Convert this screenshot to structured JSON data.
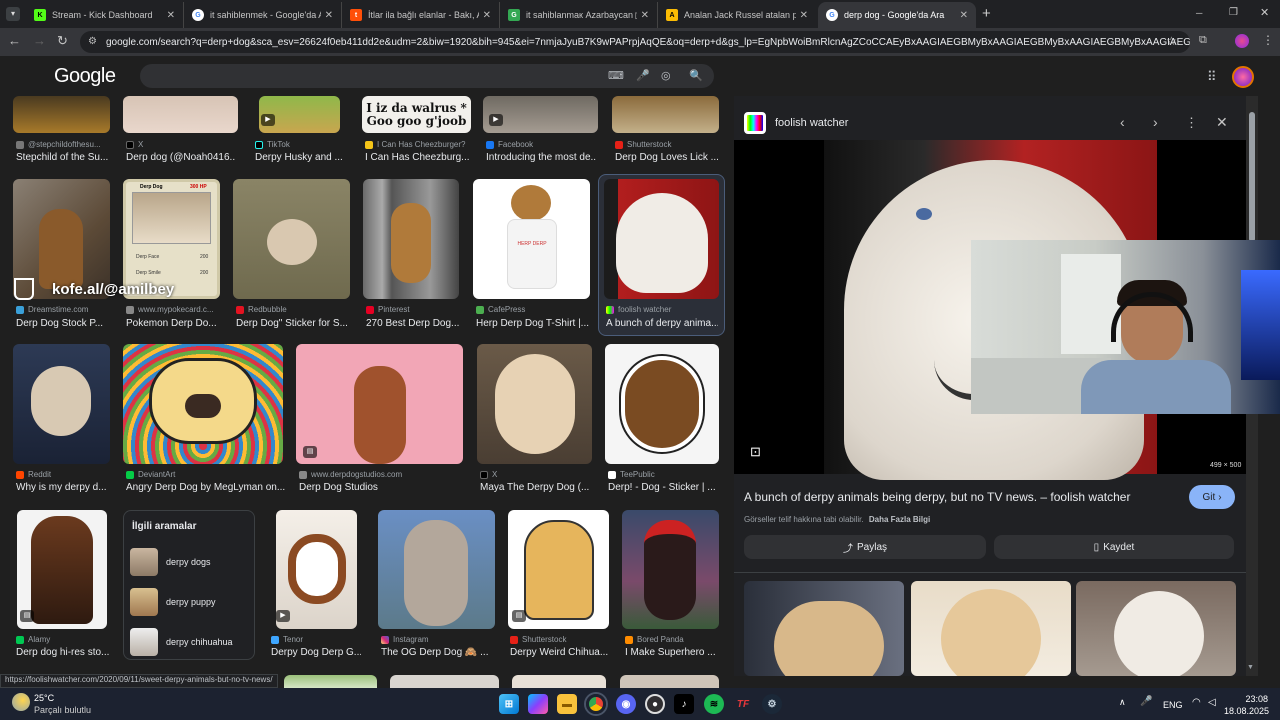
{
  "browser": {
    "tabs": [
      {
        "title": "Stream - Kick Dashboard",
        "active": false
      },
      {
        "title": "it sahiblenmek - Google'da Ara",
        "active": false
      },
      {
        "title": "İtlar ila bağlı elanlar - Bakı, Azə",
        "active": false
      },
      {
        "title": "it sahiblanmaк Azarbaycan ▷ M",
        "active": false
      },
      {
        "title": "Analan Jack Russel atalan pekin",
        "active": false
      },
      {
        "title": "derp dog - Google'da Ara",
        "active": true
      }
    ],
    "new_tab": "+",
    "window_controls": {
      "minimize": "─",
      "restore": "❐",
      "close": "✕"
    },
    "url": "google.com/search?q=derp+dog&sca_esv=26624f0eb411dd2e&udm=2&biw=1920&bih=945&ei=7nmjaJyuB7K9wPAPrpjAqQE&oq=derp+d&gs_lp=EgNpbWoiBmRlcnAgZCoCCAEyBxAAGIAEGBMyBxAAGIAEGBMyBxAAGIAEGBMyBxAAGIAEGBMyBxAAGIAEGBMyBxAAGIAEGBMyBxAAGIAEGBMyBxAAGIAEGBMyBxAAGIAEGBMyBxAAGIA..."
  },
  "google": {
    "logo": "Google"
  },
  "results_top": [
    {
      "source": "@stepchildofthesu...",
      "caption": "Stepchild of the Su..."
    },
    {
      "source": "X",
      "caption": "Derp dog (@Noah0416..."
    },
    {
      "source": "TikTok",
      "caption": "Derpy Husky and ..."
    },
    {
      "source": "I Can Has Cheezburger?",
      "caption": "I Can Has Cheezburg...",
      "meme_text": "I iz da walrus *\nGoo goo g'joob"
    },
    {
      "source": "Facebook",
      "caption": "Introducing the most de..."
    },
    {
      "source": "Shutterstock",
      "caption": "Derp Dog Loves Lick ..."
    }
  ],
  "results_row2": [
    {
      "source": "Dreamstime.com",
      "caption": "Derp Dog Stock P..."
    },
    {
      "source": "www.mypokecard.c...",
      "caption": "Pokemon Derp Do..."
    },
    {
      "source": "Redbubble",
      "caption": "Derp Dog\" Sticker for S..."
    },
    {
      "source": "Pinterest",
      "caption": "270 Best Derp Dog..."
    },
    {
      "source": "CafePress",
      "caption": "Herp Derp Dog T-Shirt |..."
    },
    {
      "source": "foolish watcher",
      "caption": "A bunch of derpy anima..."
    }
  ],
  "results_row3": [
    {
      "source": "Reddit",
      "caption": "Why is my derpy d..."
    },
    {
      "source": "DeviantArt",
      "caption": "Angry Derp Dog by MegLyman on..."
    },
    {
      "source": "www.derpdogstudios.com",
      "caption": "Derp Dog Studios"
    },
    {
      "source": "X",
      "caption": "Maya The Derpy Dog (..."
    },
    {
      "source": "TeePublic",
      "caption": "Derp! - Dog - Sticker | ..."
    }
  ],
  "results_row4": [
    {
      "source": "Alamy",
      "caption": "Derp dog hi-res sto..."
    },
    {
      "source": "Tenor",
      "caption": "Derpy Dog Derp G..."
    },
    {
      "source": "Instagram",
      "caption": "The OG Derp Dog 🙈 ..."
    },
    {
      "source": "Shutterstock",
      "caption": "Derpy Weird Chihua..."
    },
    {
      "source": "Bored Panda",
      "caption": "I Make Superhero ..."
    }
  ],
  "related": {
    "title": "İlgili aramalar",
    "items": [
      "derpy dogs",
      "derpy puppy",
      "derpy chihuahua"
    ]
  },
  "pokecard": {
    "name": "Derp Dog",
    "hp": "300 HP",
    "move1": "Derp Face",
    "move2": "Derp Smile",
    "dmg1": "200",
    "dmg2": "200"
  },
  "tshirt_text": "HERP DERP",
  "watermark": "kofe.al/@amilbey",
  "panel": {
    "site_name": "foolish watcher",
    "image_size": "499 × 500",
    "title": "A bunch of derpy animals being derpy, but no TV news. – foolish watcher",
    "visit_label": "Git",
    "copyright_text": "Görseller telif hakkına tabi olabilir.",
    "more_info": "Daha Fazla Bilgi",
    "share_label": "Paylaş",
    "save_label": "Kaydet"
  },
  "status_url": "https://foolishwatcher.com/2020/09/11/sweet-derpy-animals-but-no-tv-news/",
  "weather": {
    "temp": "25°C",
    "desc": "Parçalı bulutlu"
  },
  "tray": {
    "lang": "ENG",
    "time": "23:08",
    "date": "18.08.2025"
  },
  "colors": {
    "accent": "#8ab4f8",
    "background": "#1f1f1f",
    "panel": "#202124",
    "taskbar": "#1c2230"
  }
}
